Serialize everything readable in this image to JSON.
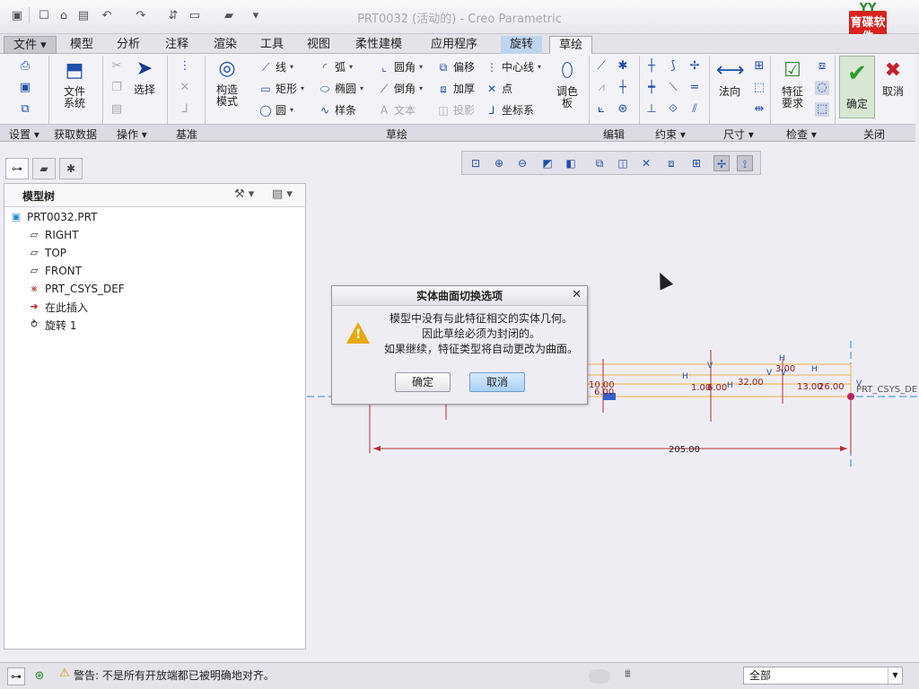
{
  "window": {
    "title": "PRT0032 (活动的) - Creo Parametric"
  },
  "logo": {
    "text": "育碟软件",
    "top": "YY"
  },
  "quick_access": [
    "new-icon",
    "open-icon",
    "save-icon",
    "undo-icon",
    "redo-icon",
    "regenerate-icon",
    "window-icon",
    "folder-icon",
    "more-icon"
  ],
  "tabs": [
    "文件",
    "模型",
    "分析",
    "注释",
    "渲染",
    "工具",
    "视图",
    "柔性建模",
    "应用程序",
    "旋转",
    "草绘"
  ],
  "active_tab": "草绘",
  "ribbon": {
    "file_system": "文件\n系统",
    "select": "选择",
    "construct_mode": "构造\n模式",
    "palette": "调色\n板",
    "normal": "法向",
    "feature_req": "特征\n要求",
    "ok": "确定",
    "cancel": "取消",
    "sketch_items": {
      "line": "线",
      "arc": "弧",
      "fillet": "圆角",
      "offset": "偏移",
      "centerline": "中心线",
      "rect": "矩形",
      "ellipse": "椭圆",
      "chamfer": "倒角",
      "thicken": "加厚",
      "point": "点",
      "circle": "圆",
      "spline": "样条",
      "text": "文本",
      "project": "投影",
      "csys": "坐标系"
    }
  },
  "groups": [
    "设置",
    "获取数据",
    "操作",
    "基准",
    "草绘",
    "编辑",
    "约束",
    "尺寸",
    "检查",
    "关闭"
  ],
  "model_tree": {
    "title": "模型树",
    "items": [
      "PRT0032.PRT",
      "RIGHT",
      "TOP",
      "FRONT",
      "PRT_CSYS_DEF",
      "在此插入",
      "旋转 1"
    ]
  },
  "sketch": {
    "dim_main": "205.00",
    "dims": [
      "10.00",
      "6.00",
      "1.00",
      "32.00",
      "3.00",
      "13.00",
      "26.00",
      "6.00",
      "10.00"
    ],
    "h_labels": [
      "H",
      "H",
      "H",
      "H"
    ],
    "v_labels": [
      "V",
      "V",
      "V",
      "V"
    ],
    "csys": "PRT_CSYS_DE"
  },
  "dialog": {
    "title": "实体曲面切换选项",
    "lines": [
      "模型中没有与此特征相交的实体几何。",
      "因此草绘必须为封闭的。",
      "如果继续，特征类型将自动更改为曲面。"
    ],
    "ok": "确定",
    "cancel": "取消"
  },
  "status": {
    "message": "警告: 不是所有开放端都已被明确地对齐。",
    "filter": "全部"
  }
}
